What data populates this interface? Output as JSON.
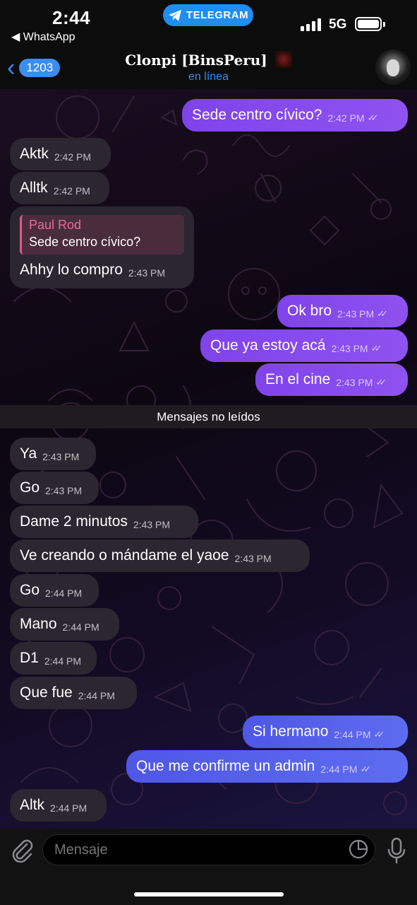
{
  "status_bar": {
    "time": "2:44",
    "back_app": "◀ WhatsApp",
    "pill_label": "TELEGRAM",
    "network": "5G",
    "signal_bars": 4,
    "battery_level": 0.95
  },
  "header": {
    "back_count": "1203",
    "title": "Clonpi [BinsPeru]",
    "status": "en línea"
  },
  "messages": [
    {
      "text": "Sede centro cívico?",
      "time": "2:42 PM",
      "dir": "out"
    },
    {
      "text": "Aktk",
      "time": "2:42 PM",
      "dir": "in"
    },
    {
      "text": "Alltk",
      "time": "2:42 PM",
      "dir": "in"
    },
    {
      "text": "Ok bro",
      "time": "2:43 PM",
      "dir": "out"
    },
    {
      "text": "Que ya estoy acá",
      "time": "2:43 PM",
      "dir": "out"
    },
    {
      "text": "En el cine",
      "time": "2:43 PM",
      "dir": "out"
    },
    {
      "text": "Ya",
      "time": "2:43 PM",
      "dir": "in"
    },
    {
      "text": "Go",
      "time": "2:43 PM",
      "dir": "in"
    },
    {
      "text": "Dame 2 minutos",
      "time": "2:43 PM",
      "dir": "in"
    },
    {
      "text": "Ve creando o mándame el yaoe",
      "time": "2:43 PM",
      "dir": "in"
    },
    {
      "text": "Go",
      "time": "2:44 PM",
      "dir": "in"
    },
    {
      "text": "Mano",
      "time": "2:44 PM",
      "dir": "in"
    },
    {
      "text": "D1",
      "time": "2:44 PM",
      "dir": "in"
    },
    {
      "text": "Que fue",
      "time": "2:44 PM",
      "dir": "in"
    },
    {
      "text": "Si hermano",
      "time": "2:44 PM",
      "dir": "out"
    },
    {
      "text": "Que me confirme un admin",
      "time": "2:44 PM",
      "dir": "out"
    },
    {
      "text": "Altk",
      "time": "2:44 PM",
      "dir": "in"
    }
  ],
  "reply_message": {
    "quote_name": "Paul Rod",
    "quote_text": "Sede centro cívico?",
    "text": "Ahhy lo compro",
    "time": "2:43 PM"
  },
  "unread_divider": "Mensajes no leídos",
  "input": {
    "placeholder": "Mensaje"
  },
  "colors": {
    "accent": "#3b8ef0",
    "outgoing_bubble": "#8a4cef",
    "outgoing_bubble_blue": "#5862ea",
    "incoming_bubble": "#2b2630",
    "quote_name": "#e86a98"
  },
  "icons": {
    "attach": "paperclip-icon",
    "sticker": "sticker-icon",
    "mic": "microphone-icon",
    "read": "double-check-icon",
    "telegram": "telegram-plane-icon"
  }
}
